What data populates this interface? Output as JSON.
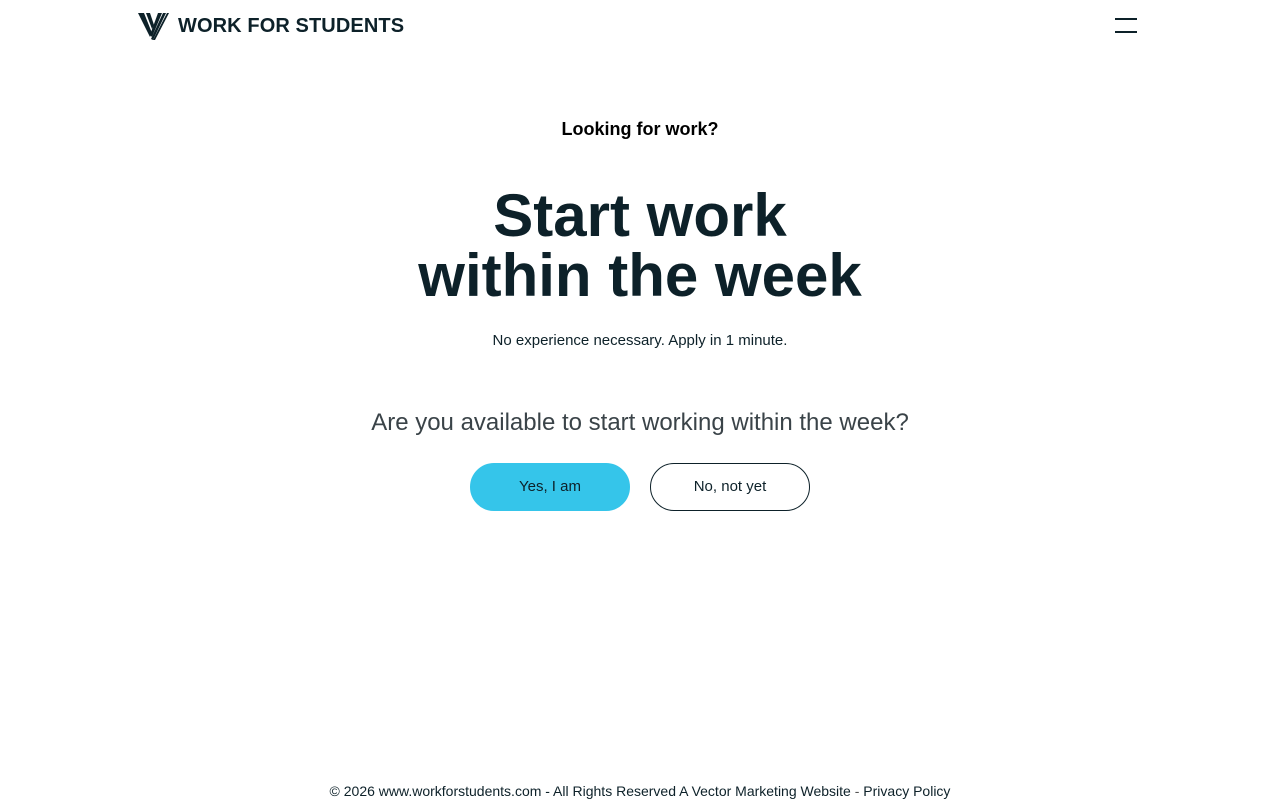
{
  "header": {
    "brand_name": "WORK FOR STUDENTS",
    "logo_icon": "vector-stripes-logo",
    "menu_icon": "hamburger-menu-icon"
  },
  "hero": {
    "eyebrow": "Looking for work?",
    "headline_line1": "Start work",
    "headline_line2": "within the week",
    "subhead": "No experience necessary. Apply in 1 minute.",
    "question": "Are you available to start working within the week?",
    "yes_label": "Yes, I am",
    "no_label": "No, not yet"
  },
  "footer": {
    "copyright": "© 2026 www.workforstudents.com - All Rights Reserved",
    "vector_link": "A Vector Marketing Website",
    "separator": "-",
    "privacy_link": "Privacy Policy"
  },
  "colors": {
    "text_dark": "#0d2129",
    "accent": "#35c5ea",
    "question_text": "#3a4348",
    "background": "#ffffff"
  }
}
